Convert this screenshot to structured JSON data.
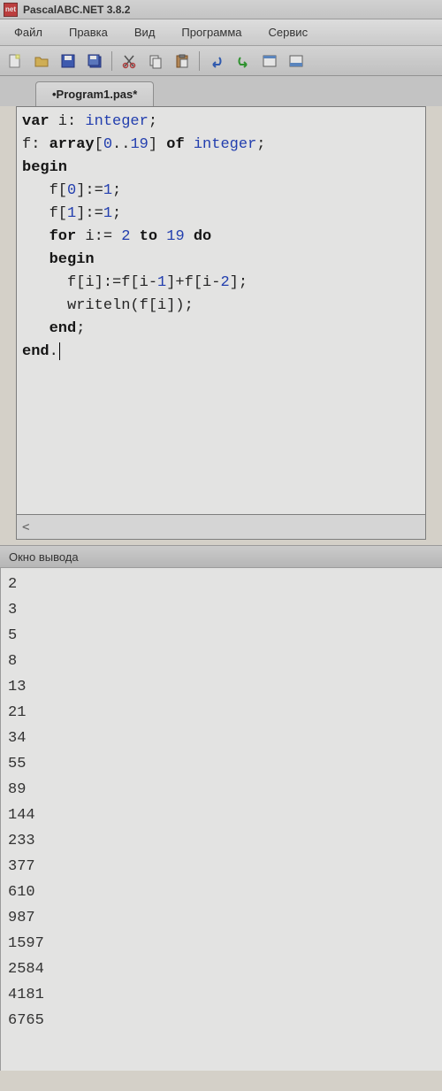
{
  "app": {
    "title": "PascalABC.NET 3.8.2",
    "icon_label": "net"
  },
  "menu": {
    "file": "Файл",
    "edit": "Правка",
    "view": "Вид",
    "program": "Программа",
    "service": "Сервис"
  },
  "toolbar_icons": {
    "new": "new-file-icon",
    "open": "open-folder-icon",
    "save": "save-icon",
    "save_all": "save-all-icon",
    "cut": "cut-icon",
    "copy": "copy-icon",
    "paste": "paste-icon",
    "undo": "undo-icon",
    "redo": "redo-icon",
    "btn1": "panel-icon",
    "btn2": "panel2-icon"
  },
  "tab": {
    "label": "•Program1.pas*"
  },
  "code": {
    "tokens": [
      [
        {
          "t": "var",
          "c": "kw"
        },
        {
          "t": " i: "
        },
        {
          "t": "integer",
          "c": "type"
        },
        {
          "t": ";"
        }
      ],
      [
        {
          "t": "f: "
        },
        {
          "t": "array",
          "c": "kw"
        },
        {
          "t": "["
        },
        {
          "t": "0",
          "c": "num"
        },
        {
          "t": ".."
        },
        {
          "t": "19",
          "c": "num"
        },
        {
          "t": "] "
        },
        {
          "t": "of",
          "c": "kw"
        },
        {
          "t": " "
        },
        {
          "t": "integer",
          "c": "type"
        },
        {
          "t": ";"
        }
      ],
      [
        {
          "t": "begin",
          "c": "kw"
        }
      ],
      [
        {
          "t": "   f["
        },
        {
          "t": "0",
          "c": "num"
        },
        {
          "t": "]:="
        },
        {
          "t": "1",
          "c": "num"
        },
        {
          "t": ";"
        }
      ],
      [
        {
          "t": "   f["
        },
        {
          "t": "1",
          "c": "num"
        },
        {
          "t": "]:="
        },
        {
          "t": "1",
          "c": "num"
        },
        {
          "t": ";"
        }
      ],
      [
        {
          "t": "   "
        },
        {
          "t": "for",
          "c": "kw"
        },
        {
          "t": " i:= "
        },
        {
          "t": "2",
          "c": "num"
        },
        {
          "t": " "
        },
        {
          "t": "to",
          "c": "kw"
        },
        {
          "t": " "
        },
        {
          "t": "19",
          "c": "num"
        },
        {
          "t": " "
        },
        {
          "t": "do",
          "c": "kw"
        }
      ],
      [
        {
          "t": "   "
        },
        {
          "t": "begin",
          "c": "kw"
        }
      ],
      [
        {
          "t": "     f[i]:=f[i-"
        },
        {
          "t": "1",
          "c": "num"
        },
        {
          "t": "]+f[i-"
        },
        {
          "t": "2",
          "c": "num"
        },
        {
          "t": "];"
        }
      ],
      [
        {
          "t": "     writeln(f[i]);"
        }
      ],
      [
        {
          "t": "   "
        },
        {
          "t": "end",
          "c": "kw"
        },
        {
          "t": ";"
        }
      ],
      [
        {
          "t": "end",
          "c": "kw"
        },
        {
          "t": "."
        }
      ]
    ]
  },
  "scroll": {
    "char": "<"
  },
  "output_panel": {
    "title": "Окно вывода",
    "lines": [
      "2",
      "3",
      "5",
      "8",
      "13",
      "21",
      "34",
      "55",
      "89",
      "144",
      "233",
      "377",
      "610",
      "987",
      "1597",
      "2584",
      "4181",
      "6765"
    ]
  }
}
